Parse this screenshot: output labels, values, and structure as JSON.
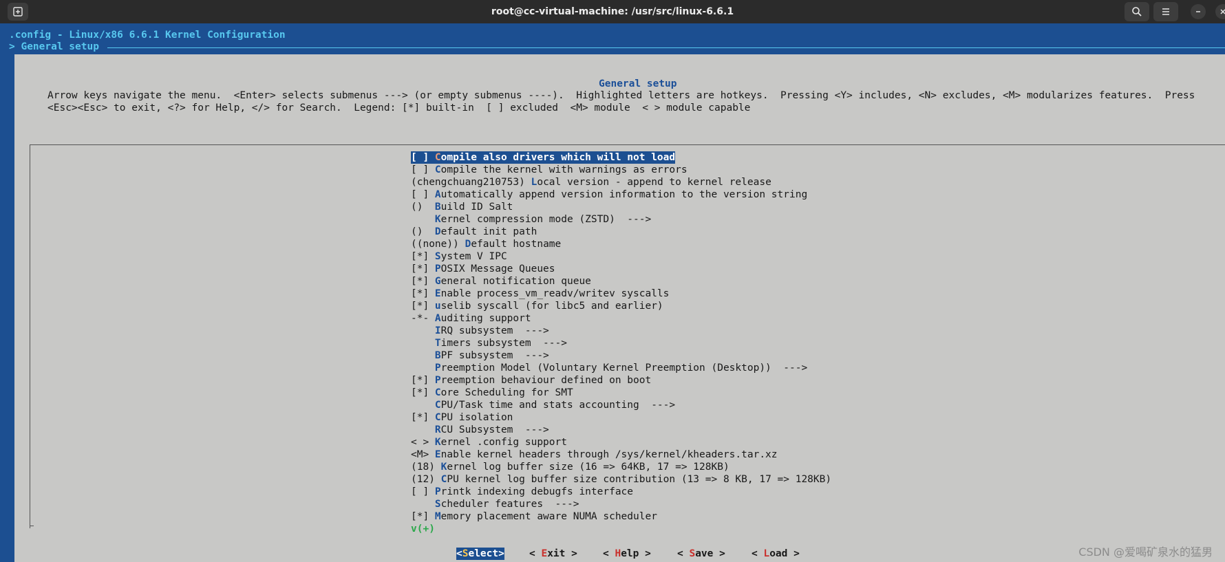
{
  "window": {
    "title": "root@cc-virtual-machine: /usr/src/linux-6.6.1",
    "icons": [
      "new-tab-icon",
      "search-icon",
      "hamburger-menu-icon",
      "minimize-icon",
      "close-icon"
    ]
  },
  "header": {
    "config_line": ".config - Linux/x86 6.6.1 Kernel Configuration",
    "breadcrumb": "> General setup"
  },
  "dialog": {
    "title": "General setup",
    "help_line_1": "Arrow keys navigate the menu.  <Enter> selects submenus ---> (or empty submenus ----).  Highlighted letters are hotkeys.  Pressing <Y> includes, <N> excludes, <M> modularizes features.  Press",
    "help_line_2": "<Esc><Esc> to exit, <?> for Help, </> for Search.  Legend: [*] built-in  [ ] excluded  <M> module  < > module capable"
  },
  "menu": {
    "items": [
      {
        "prefix": "[ ] ",
        "hotkey": "C",
        "rest": "ompile also drivers which will not load"
      },
      {
        "prefix": "[ ] ",
        "hotkey": "C",
        "rest": "ompile the kernel with warnings as errors"
      },
      {
        "prefix": "(chengchuang210753) ",
        "hotkey": "L",
        "rest": "ocal version - append to kernel release"
      },
      {
        "prefix": "[ ] ",
        "hotkey": "A",
        "rest": "utomatically append version information to the version string"
      },
      {
        "prefix": "()  ",
        "hotkey": "B",
        "rest": "uild ID Salt"
      },
      {
        "prefix": "    ",
        "hotkey": "K",
        "rest": "ernel compression mode (ZSTD)  --->"
      },
      {
        "prefix": "()  ",
        "hotkey": "D",
        "rest": "efault init path"
      },
      {
        "prefix": "((none)) ",
        "hotkey": "D",
        "rest": "efault hostname"
      },
      {
        "prefix": "[*] ",
        "hotkey": "S",
        "rest": "ystem V IPC"
      },
      {
        "prefix": "[*] ",
        "hotkey": "P",
        "rest": "OSIX Message Queues"
      },
      {
        "prefix": "[*] ",
        "hotkey": "G",
        "rest": "eneral notification queue"
      },
      {
        "prefix": "[*] ",
        "hotkey": "E",
        "rest": "nable process_vm_readv/writev syscalls"
      },
      {
        "prefix": "[*] ",
        "hotkey": "u",
        "rest": "selib syscall (for libc5 and earlier)"
      },
      {
        "prefix": "-*- ",
        "hotkey": "A",
        "rest": "uditing support"
      },
      {
        "prefix": "    ",
        "hotkey": "I",
        "rest": "RQ subsystem  --->"
      },
      {
        "prefix": "    ",
        "hotkey": "T",
        "rest": "imers subsystem  --->"
      },
      {
        "prefix": "    ",
        "hotkey": "B",
        "rest": "PF subsystem  --->"
      },
      {
        "prefix": "    ",
        "hotkey": "P",
        "rest": "reemption Model (Voluntary Kernel Preemption (Desktop))  --->"
      },
      {
        "prefix": "[*] ",
        "hotkey": "P",
        "rest": "reemption behaviour defined on boot"
      },
      {
        "prefix": "[*] ",
        "hotkey": "C",
        "rest": "ore Scheduling for SMT"
      },
      {
        "prefix": "    ",
        "hotkey": "C",
        "rest": "PU/Task time and stats accounting  --->"
      },
      {
        "prefix": "[*] ",
        "hotkey": "C",
        "rest": "PU isolation"
      },
      {
        "prefix": "    ",
        "hotkey": "R",
        "rest": "CU Subsystem  --->"
      },
      {
        "prefix": "< > ",
        "hotkey": "K",
        "rest": "ernel .config support"
      },
      {
        "prefix": "<M> ",
        "hotkey": "E",
        "rest": "nable kernel headers through /sys/kernel/kheaders.tar.xz"
      },
      {
        "prefix": "(18) ",
        "hotkey": "K",
        "rest": "ernel log buffer size (16 => 64KB, 17 => 128KB)"
      },
      {
        "prefix": "(12) ",
        "hotkey": "C",
        "rest": "PU kernel log buffer size contribution (13 => 8 KB, 17 => 128KB)"
      },
      {
        "prefix": "[ ] ",
        "hotkey": "P",
        "rest": "rintk indexing debugfs interface"
      },
      {
        "prefix": "    ",
        "hotkey": "S",
        "rest": "cheduler features  --->"
      },
      {
        "prefix": "[*] ",
        "hotkey": "M",
        "rest": "emory placement aware NUMA scheduler"
      }
    ],
    "selected_index": 0,
    "more_indicator": "v(+)"
  },
  "buttons": [
    {
      "pre": "<",
      "hotkey": "S",
      "post": "elect>"
    },
    {
      "pre": "< ",
      "hotkey": "E",
      "post": "xit >"
    },
    {
      "pre": "< ",
      "hotkey": "H",
      "post": "elp >"
    },
    {
      "pre": "< ",
      "hotkey": "S",
      "post": "ave >"
    },
    {
      "pre": "< ",
      "hotkey": "L",
      "post": "oad >"
    }
  ],
  "watermark": "CSDN @爱喝矿泉水的猛男",
  "colors": {
    "terminal_bg": "#1c4f91",
    "dialog_bg": "#c8c8c6",
    "header_text": "#58c8ef",
    "hotkey": "#1b4f98",
    "button_hotkey": "#c9302c",
    "more_indicator": "#2ba84a"
  }
}
